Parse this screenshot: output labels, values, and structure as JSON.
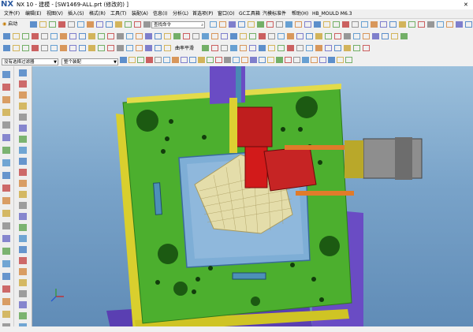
{
  "app": {
    "logo": "NX",
    "title": "NX 10 - 建模 - [SW1469-ALL.prt  (修改的) ]"
  },
  "menu": [
    "文件(F)",
    "编辑(E)",
    "视图(V)",
    "插入(S)",
    "格式(R)",
    "工具(T)",
    "装配(A)",
    "信息(I)",
    "分析(L)",
    "首选项(P)",
    "窗口(O)",
    "GC工具箱",
    "汽模标准件",
    "帮助(H)",
    "HB_MOULD M6.3"
  ],
  "toolbar": {
    "start_label": "启动",
    "search_placeholder": "查找命令",
    "sketch_label": "曲率平滑"
  },
  "filters": {
    "selection_filter": "没有选择过滤器",
    "assembly_scope": "整个装配"
  },
  "colors": {
    "viewport_bg": "#79a3c9",
    "mold_plate": "#4caf2e",
    "plate_yellow": "#d9cf2e",
    "purple": "#6a4cc4",
    "cylinder_red": "#d21a1a"
  },
  "icons": {
    "logo": "nx-logo-icon",
    "triad": "wcs-triad-icon"
  }
}
